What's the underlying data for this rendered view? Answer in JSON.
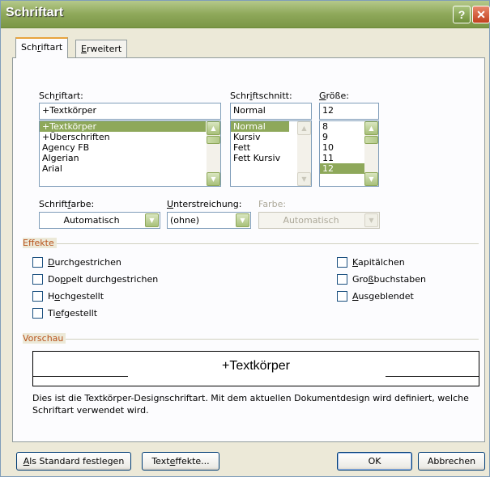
{
  "window": {
    "title": "Schriftart"
  },
  "tabs": [
    {
      "label": "Schriftart",
      "mn": "r",
      "pre": "Sch",
      "post": "iftart"
    },
    {
      "label": "Erweitert",
      "pre": "",
      "mn": "E",
      "post": "rweitert"
    }
  ],
  "font": {
    "label_pre": "Sch",
    "label_mn": "r",
    "label_post": "iftart:",
    "value": "+Textkörper",
    "items": [
      "+Textkörper",
      "+Überschriften",
      "Agency FB",
      "Algerian",
      "Arial"
    ],
    "selected_index": 0
  },
  "style": {
    "label_pre": "Schr",
    "label_mn": "i",
    "label_post": "ftschnitt:",
    "value": "Normal",
    "items": [
      "Normal",
      "Kursiv",
      "Fett",
      "Fett Kursiv"
    ],
    "selected_index": 0
  },
  "size": {
    "label_pre": "",
    "label_mn": "G",
    "label_post": "röße:",
    "value": "12",
    "items": [
      "8",
      "9",
      "10",
      "11",
      "12"
    ],
    "selected_index": 4
  },
  "font_color": {
    "label_pre": "Schrift",
    "label_mn": "f",
    "label_post": "arbe:",
    "value": "Automatisch"
  },
  "underline": {
    "label_pre": "",
    "label_mn": "U",
    "label_post": "nterstreichung:",
    "value": "(ohne)"
  },
  "underline_color": {
    "label": "Farbe:",
    "value": "Automatisch"
  },
  "effects": {
    "title": "Effekte",
    "left": [
      {
        "pre": "",
        "mn": "D",
        "post": "urchgestrichen",
        "checked": false
      },
      {
        "pre": "Do",
        "mn": "p",
        "post": "pelt durchgestrichen",
        "checked": false
      },
      {
        "pre": "H",
        "mn": "o",
        "post": "chgestellt",
        "checked": false
      },
      {
        "pre": "Ti",
        "mn": "e",
        "post": "fgestellt",
        "checked": false
      }
    ],
    "right": [
      {
        "pre": "",
        "mn": "K",
        "post": "apitälchen",
        "checked": false
      },
      {
        "pre": "Gro",
        "mn": "ß",
        "post": "buchstaben",
        "checked": false
      },
      {
        "pre": "",
        "mn": "A",
        "post": "usgeblendet",
        "checked": false
      }
    ]
  },
  "preview": {
    "title": "Vorschau",
    "sample": "+Textkörper",
    "description": "Dies ist die Textkörper-Designschriftart. Mit dem aktuellen Dokumentdesign wird definiert, welche Schriftart verwendet wird."
  },
  "buttons": {
    "set_default_pre": "",
    "set_default_mn": "A",
    "set_default_post": "ls Standard festlegen",
    "text_effects_pre": "Text",
    "text_effects_mn": "e",
    "text_effects_post": "ffekte...",
    "ok": "OK",
    "cancel": "Abbrechen"
  },
  "colors": {
    "title_green": "#8ea85a",
    "group_title": "#b8531b",
    "selection": "#8ea85a"
  }
}
